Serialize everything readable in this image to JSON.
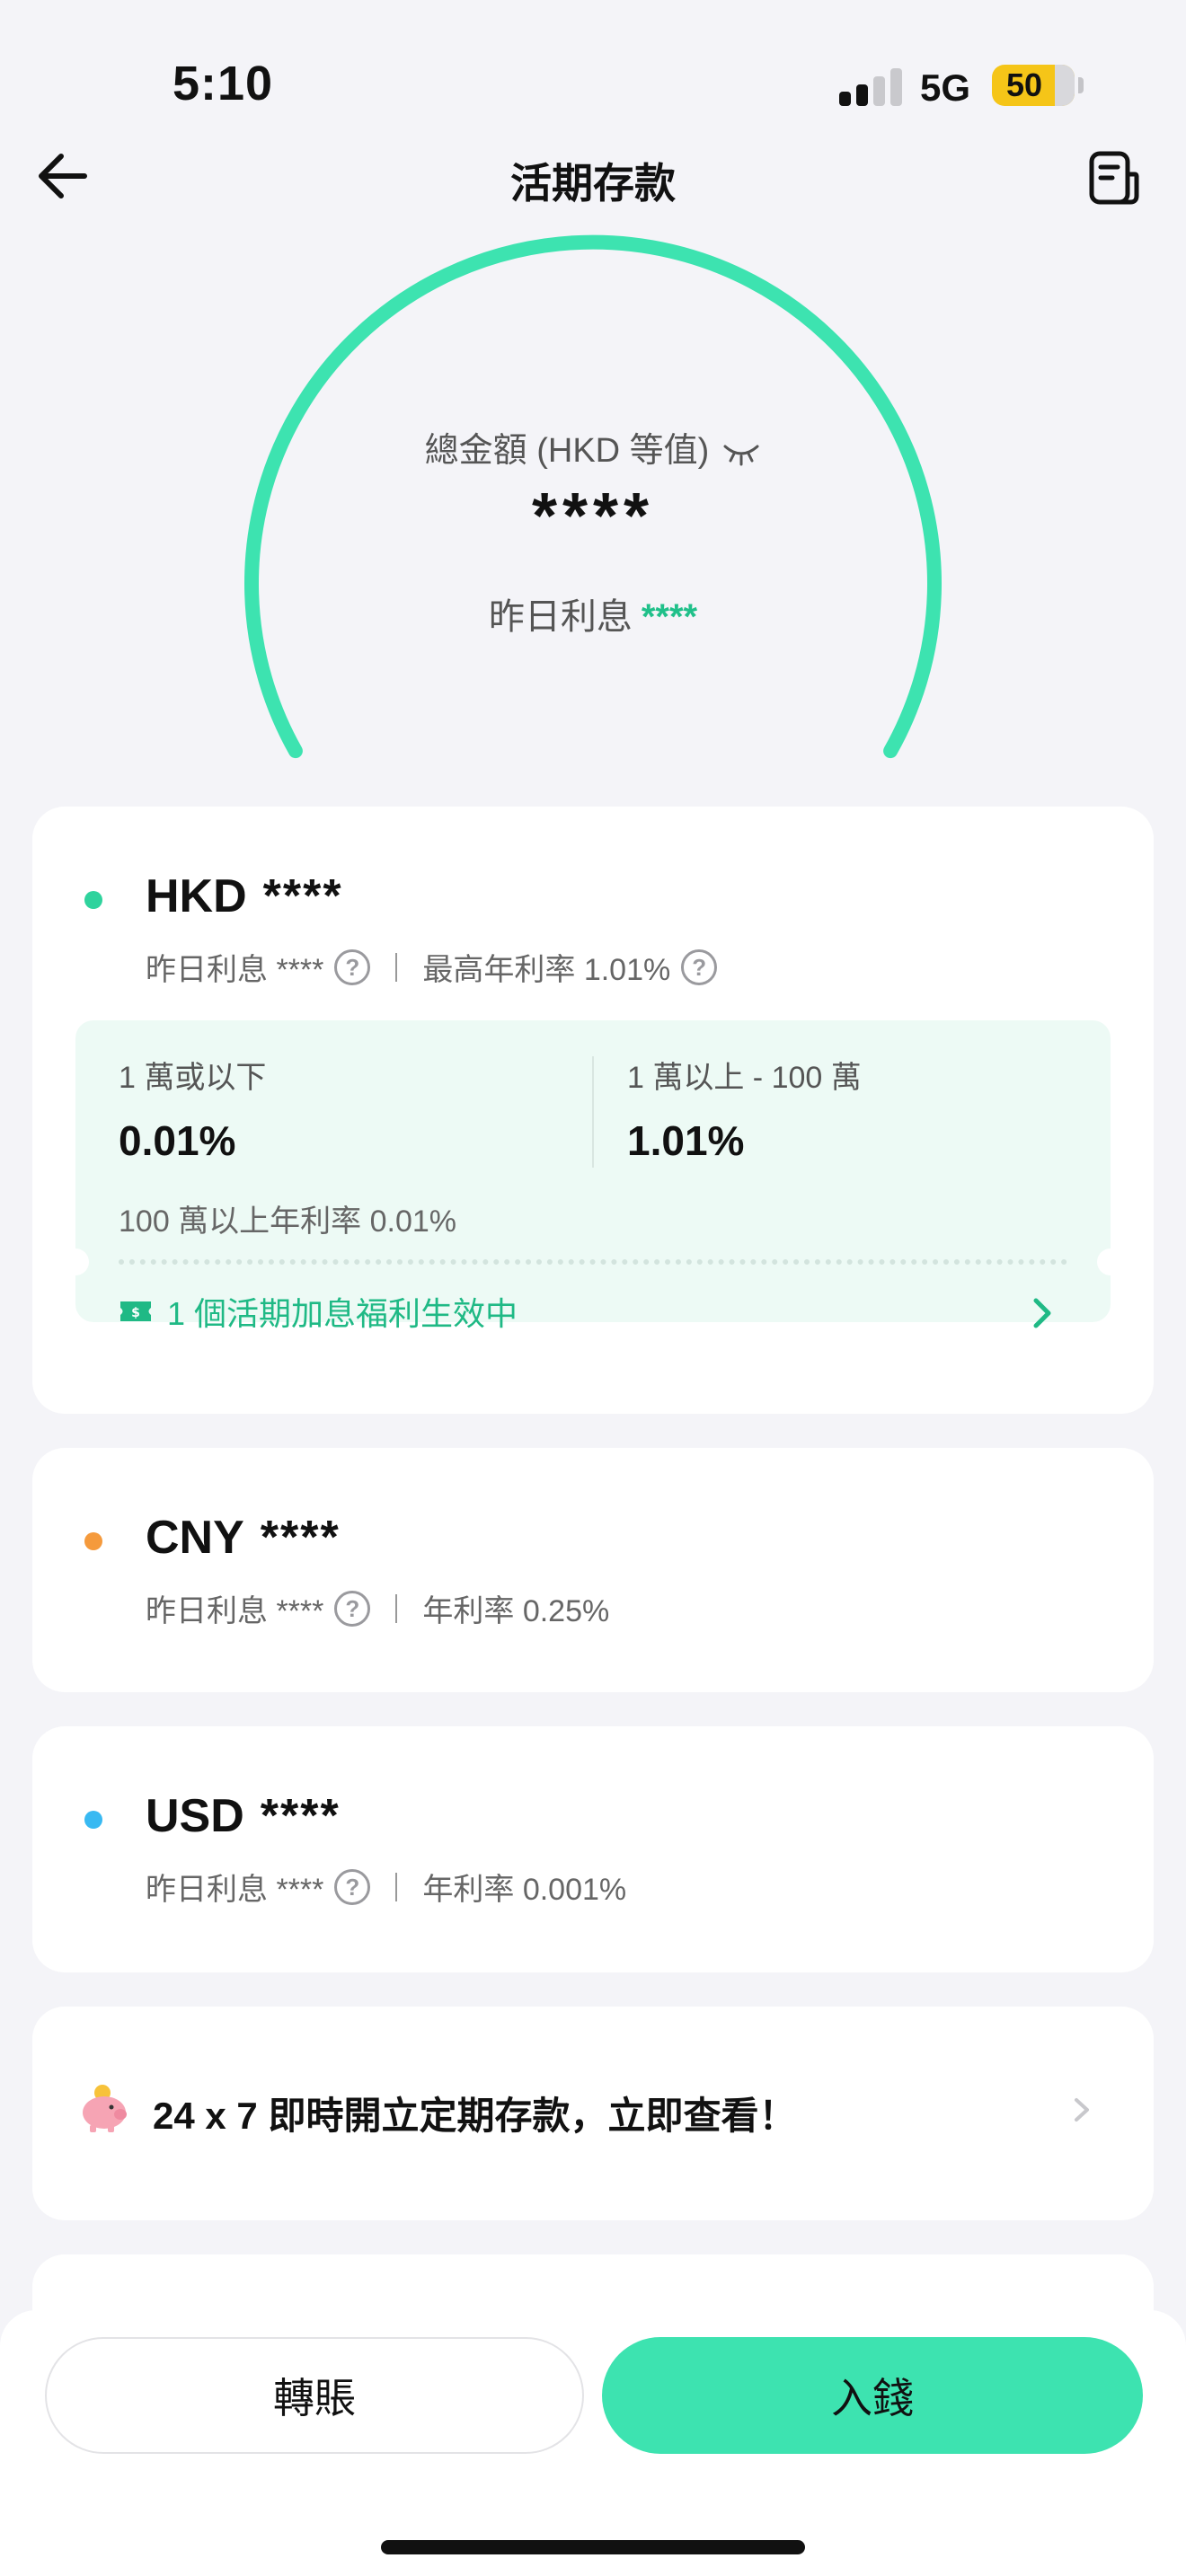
{
  "status_bar": {
    "time": "5:10",
    "network": "5G",
    "battery": "50"
  },
  "nav": {
    "title": "活期存款",
    "back_icon": "arrow-left-icon",
    "statement_icon": "document-icon"
  },
  "summary": {
    "total_label": "總金額 (HKD 等值)",
    "total_amount": "****",
    "yesterday_label": "昨日利息",
    "yesterday_value": "****",
    "gauge_color": "#3de3b0"
  },
  "accounts": [
    {
      "currency": "HKD",
      "balance": "****",
      "dot_color": "#2fd39d",
      "interest_label": "昨日利息 ****",
      "rate_text": "最高年利率 1.01%",
      "tiers": [
        {
          "label": "1 萬或以下",
          "rate": "0.01%"
        },
        {
          "label": "1 萬以上 - 100 萬",
          "rate": "1.01%"
        }
      ],
      "tier_note": "100 萬以上年利率 0.01%",
      "benefit": "1 個活期加息福利生效中"
    },
    {
      "currency": "CNY",
      "balance": "****",
      "dot_color": "#f59a3c",
      "interest_label": "昨日利息 ****",
      "rate_text": "年利率 0.25%"
    },
    {
      "currency": "USD",
      "balance": "****",
      "dot_color": "#38b9f2",
      "interest_label": "昨日利息 ****",
      "rate_text": "年利率 0.001%"
    }
  ],
  "promo": {
    "text": "24 x 7 即時開立定期存款，立即查看！",
    "icon": "piggy-bank-icon"
  },
  "actions": {
    "transfer": "轉賬",
    "deposit": "入錢"
  },
  "colors": {
    "accent": "#3de3b0",
    "accent_text": "#1fb985",
    "background": "#f4f4f8"
  }
}
